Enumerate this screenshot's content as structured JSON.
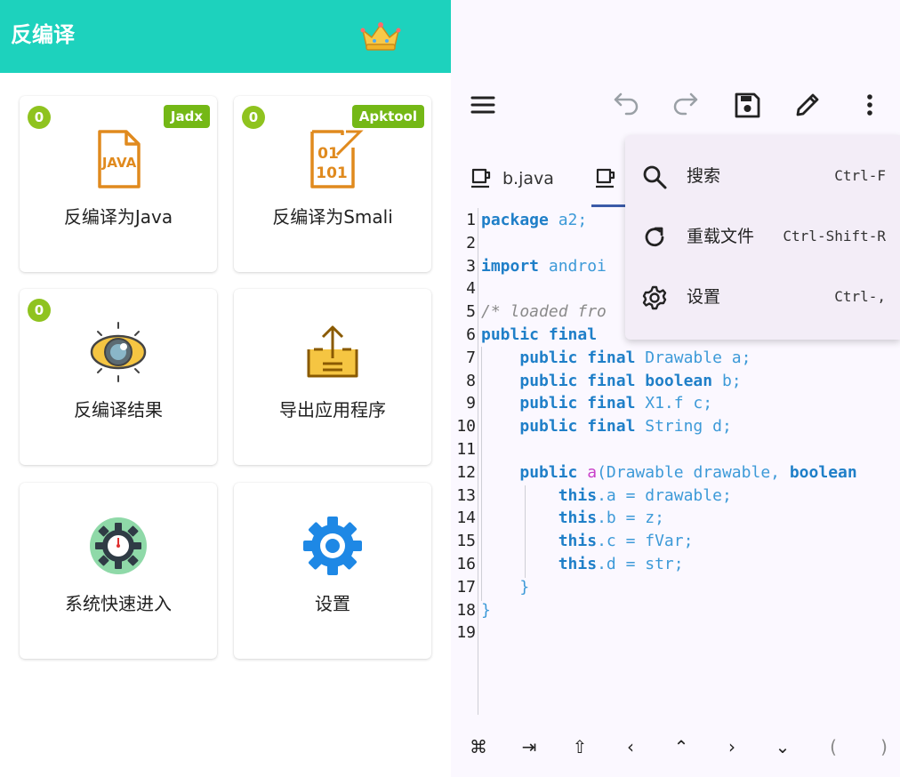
{
  "left_panel": {
    "title": "反编译",
    "cards": [
      {
        "label": "反编译为Java",
        "count": "0",
        "tool": "Jadx"
      },
      {
        "label": "反编译为Smali",
        "count": "0",
        "tool": "Apktool"
      },
      {
        "label": "反编译结果",
        "count": "0"
      },
      {
        "label": "导出应用程序"
      },
      {
        "label": "系统快速进入"
      },
      {
        "label": "设置"
      }
    ],
    "icons": {
      "premium": "crown-icon",
      "java": "java-file-icon",
      "smali": "binary-file-icon",
      "result": "eye-scan-icon",
      "export": "export-tray-icon",
      "system": "gear-clock-icon",
      "settings": "gear-icon"
    }
  },
  "editor": {
    "toolbar_icons": [
      "menu-icon",
      "undo-icon",
      "redo-icon",
      "save-icon",
      "edit-pencil-icon",
      "more-vert-icon"
    ],
    "tab": {
      "label": "b.java"
    },
    "lines": [
      {
        "n": "1",
        "tokens": [
          [
            "kw",
            "package"
          ],
          [
            "pl",
            " a2;"
          ]
        ]
      },
      {
        "n": "2",
        "tokens": []
      },
      {
        "n": "3",
        "tokens": [
          [
            "kw",
            "import"
          ],
          [
            "pl",
            " androi"
          ]
        ]
      },
      {
        "n": "4",
        "tokens": []
      },
      {
        "n": "5",
        "tokens": [
          [
            "cm",
            "/* loaded fro"
          ]
        ]
      },
      {
        "n": "6",
        "tokens": [
          [
            "kw",
            "public final"
          ],
          [
            "pl",
            " "
          ]
        ]
      },
      {
        "n": "7",
        "tokens": [
          [
            "pl",
            "    "
          ],
          [
            "kw",
            "public final"
          ],
          [
            "ty",
            " Drawable"
          ],
          [
            "pl",
            " a;"
          ]
        ]
      },
      {
        "n": "8",
        "tokens": [
          [
            "pl",
            "    "
          ],
          [
            "kw",
            "public final boolean"
          ],
          [
            "pl",
            " b;"
          ]
        ]
      },
      {
        "n": "9",
        "tokens": [
          [
            "pl",
            "    "
          ],
          [
            "kw",
            "public final"
          ],
          [
            "ty",
            " X1.f"
          ],
          [
            "pl",
            " c;"
          ]
        ]
      },
      {
        "n": "10",
        "tokens": [
          [
            "pl",
            "    "
          ],
          [
            "kw",
            "public final"
          ],
          [
            "ty",
            " String"
          ],
          [
            "pl",
            " d;"
          ]
        ]
      },
      {
        "n": "11",
        "tokens": []
      },
      {
        "n": "12",
        "tokens": [
          [
            "pl",
            "    "
          ],
          [
            "kw",
            "public"
          ],
          [
            "fn",
            " a"
          ],
          [
            "pl",
            "("
          ],
          [
            "ty",
            "Drawable"
          ],
          [
            "pl",
            " drawable, "
          ],
          [
            "kw",
            "boolean"
          ]
        ]
      },
      {
        "n": "13",
        "tokens": [
          [
            "pl",
            "        "
          ],
          [
            "kw",
            "this"
          ],
          [
            "pl",
            ".a = drawable;"
          ]
        ]
      },
      {
        "n": "14",
        "tokens": [
          [
            "pl",
            "        "
          ],
          [
            "kw",
            "this"
          ],
          [
            "pl",
            ".b = z;"
          ]
        ]
      },
      {
        "n": "15",
        "tokens": [
          [
            "pl",
            "        "
          ],
          [
            "kw",
            "this"
          ],
          [
            "pl",
            ".c = fVar;"
          ]
        ]
      },
      {
        "n": "16",
        "tokens": [
          [
            "pl",
            "        "
          ],
          [
            "kw",
            "this"
          ],
          [
            "pl",
            ".d = str;"
          ]
        ]
      },
      {
        "n": "17",
        "tokens": [
          [
            "pl",
            "    }"
          ]
        ]
      },
      {
        "n": "18",
        "tokens": [
          [
            "pl",
            "}"
          ]
        ]
      },
      {
        "n": "19",
        "tokens": []
      }
    ],
    "bottom_keys": [
      "⌘",
      "⇥",
      "⇧",
      "‹",
      "⌃",
      "›",
      "⌄",
      "(",
      ")"
    ]
  },
  "menu": {
    "items": [
      {
        "label": "搜索",
        "shortcut": "Ctrl-F",
        "icon": "search-icon"
      },
      {
        "label": "重载文件",
        "shortcut": "Ctrl-Shift-R",
        "icon": "reload-icon"
      },
      {
        "label": "设置",
        "shortcut": "Ctrl-,",
        "icon": "settings-gear-icon"
      }
    ]
  },
  "colors": {
    "header": "#1dd2bd",
    "badge": "#8fc31f",
    "keyword": "#1f7fc8",
    "menu_bg": "#f3edf7"
  }
}
